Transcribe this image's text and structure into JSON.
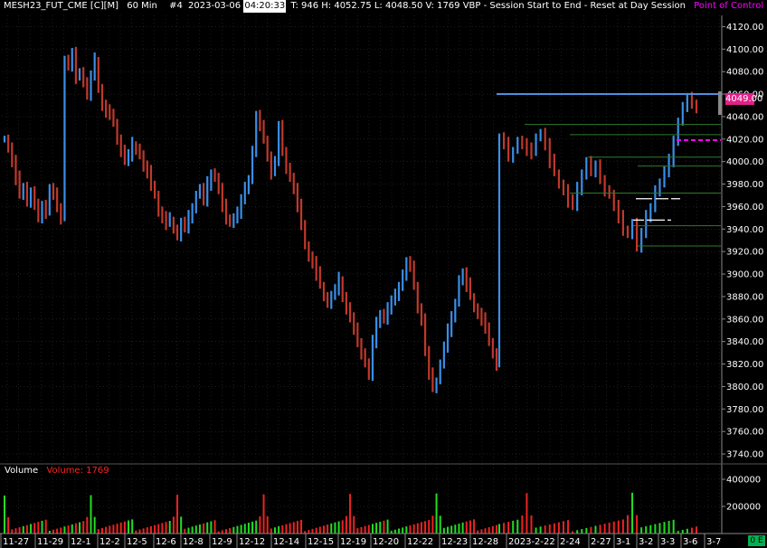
{
  "header": {
    "symbol": "MESH23_FUT_CME [C][M]",
    "interval": "60 Min",
    "bar_number": "#4",
    "date": "2023-03-06",
    "time": "04:20:33",
    "stats": "T: 946  H: 4052.75  L: 4048.50  V: 1769  VBP - Session Start to End - Reset at Day Session",
    "poc_label": "Point of Control",
    "poc_color": "#ff00ff"
  },
  "volume_panel": {
    "title": "Volume",
    "value_label": "Volume: 1769",
    "value_color": "#ff2020"
  },
  "current_price_badge": "4049.00",
  "status_badge": "0 E",
  "colors": {
    "background": "#000000",
    "up_bar": "#3a8ee6",
    "down_bar": "#c0392b",
    "vbp_line": "#2f7a2f",
    "high_line": "#4a90e2",
    "poc_dash": "#ff00ff",
    "vol_up": "#22dd22",
    "vol_down": "#ee2222",
    "grid": "#3a3a3a",
    "axis_text": "#ffffff"
  },
  "chart_data": [
    {
      "type": "line",
      "title": "",
      "y_ticks": [
        4120,
        4100,
        4080,
        4060,
        4040,
        4020,
        4000,
        3980,
        3960,
        3940,
        3920,
        3900,
        3880,
        3860,
        3840,
        3820,
        3800,
        3780,
        3760,
        3740
      ],
      "ylim": [
        3732,
        4130
      ],
      "x_tick_labels": [
        "11-27",
        "11-29",
        "12-1",
        "12-2",
        "12-5",
        "12-6",
        "12-8",
        "12-9",
        "12-12",
        "12-14",
        "12-15",
        "12-19",
        "12-20",
        "12-22",
        "12-23",
        "12-28",
        "2023-2-22",
        "2-24",
        "2-27",
        "3-1",
        "3-2",
        "3-3",
        "3-6",
        "3-7"
      ],
      "series": [
        {
          "values": [
            4020,
            4012,
            4000,
            3985,
            3970,
            3978,
            3965,
            3972,
            3960,
            3950,
            3962,
            3955,
            3975,
            3970,
            3960,
            3950,
            4090,
            4085,
            4095,
            4075,
            4080,
            4070,
            4060,
            4075,
            4090,
            4065,
            4050,
            4045,
            4040,
            4035,
            4020,
            4010,
            4000,
            4005,
            4015,
            4012,
            4005,
            3995,
            3990,
            3980,
            3970,
            3955,
            3950,
            3945,
            3948,
            3940,
            3935,
            3945,
            3940,
            3950,
            3960,
            3970,
            3975,
            3965,
            3980,
            3990,
            3985,
            3975,
            3960,
            3950,
            3945,
            3950,
            3955,
            3965,
            3975,
            3985,
            4010,
            4040,
            4030,
            4020,
            4005,
            3990,
            4000,
            4030,
            4010,
            3995,
            3985,
            3975,
            3960,
            3945,
            3925,
            3915,
            3910,
            3900,
            3890,
            3880,
            3875,
            3880,
            3885,
            3895,
            3880,
            3870,
            3860,
            3850,
            3840,
            3830,
            3820,
            3810,
            3840,
            3855,
            3865,
            3860,
            3870,
            3875,
            3880,
            3890,
            3900,
            3910,
            3905,
            3890,
            3870,
            3860,
            3830,
            3810,
            3800,
            3805,
            3820,
            3835,
            3850,
            3860,
            3875,
            3895,
            3900,
            3890,
            3880,
            3870,
            3865,
            3860,
            3850,
            3840,
            3830,
            3820,
            4020,
            4015,
            4005,
            4010,
            4018,
            4015,
            4010,
            4008,
            4022,
            4025,
            4015,
            4000,
            3990,
            3980,
            3975,
            3965,
            3960,
            3975,
            3990,
            4000,
            3990,
            3995,
            3985,
            3975,
            3970,
            3960,
            3950,
            3940,
            3935,
            3945,
            3925,
            3935,
            3950,
            3960,
            3975,
            3980,
            3990,
            4000,
            4020,
            4035,
            4048,
            4055,
            4052,
            4049
          ]
        }
      ],
      "annotations": {
        "session_high_line": 4060,
        "current_price": 4049,
        "point_of_control": 4019,
        "vbp_levels": [
          4033,
          4024,
          4004,
          3996,
          3972,
          3943,
          3925
        ],
        "white_marks": [
          3967,
          3948
        ]
      }
    },
    {
      "type": "bar",
      "title": "Volume",
      "y_ticks": [
        400000,
        200000
      ],
      "ylim": [
        0,
        480000
      ],
      "bar_count": 180
    }
  ]
}
